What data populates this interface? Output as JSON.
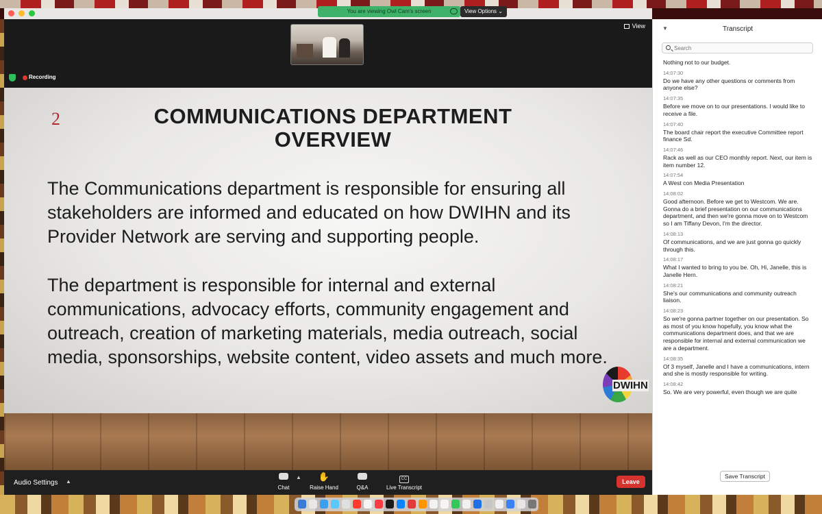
{
  "window": {
    "share_banner": "You are viewing Owl Cam's screen",
    "view_options": "View Options",
    "view_label": "View",
    "recording_label": "Recording"
  },
  "slide": {
    "number": "2",
    "title": "COMMUNICATIONS DEPARTMENT OVERVIEW",
    "paragraph_1": "The Communications department is responsible for ensuring all stakeholders are informed and educated on how DWIHN and its Provider Network are serving and supporting people.",
    "paragraph_2": "The department is responsible for internal and external communications, advocacy efforts, community engagement and outreach, creation of marketing materials, media outreach, social media, sponsorships, website content, video assets and much more.",
    "logo_text": "DWIHN"
  },
  "toolbar": {
    "audio_settings": "Audio Settings",
    "chat": "Chat",
    "raise_hand": "Raise Hand",
    "qa": "Q&A",
    "live_transcript": "Live Transcript",
    "leave": "Leave"
  },
  "transcript": {
    "title": "Transcript",
    "search_placeholder": "Search",
    "save_button": "Save Transcript",
    "entries": [
      {
        "time": "",
        "text": "Nothing not to our budget."
      },
      {
        "time": "14:07:30",
        "text": "Do we have any other questions or comments from anyone else?"
      },
      {
        "time": "14:07:35",
        "text": "Before we move on to our presentations. I would like to receive a file."
      },
      {
        "time": "14:07:40",
        "text": "The board chair report the executive Committee report finance Sd."
      },
      {
        "time": "14:07:46",
        "text": "Rack as well as our CEO monthly report. Next, our item is item number 12."
      },
      {
        "time": "14:07:54",
        "text": "A West con Media Presentation"
      },
      {
        "time": "14:08:02",
        "text": "Good afternoon. Before we get to Westcom. We are. Gonna do a brief presentation on our communications department, and then we're gonna move on to Westcom so I am Tiffany Devon, I'm the director."
      },
      {
        "time": "14:08:13",
        "text": "Of communications, and we are just gonna go quickly through this."
      },
      {
        "time": "14:08:17",
        "text": "What I wanted to bring to you be. Oh, Hi, Janelle, this is Janelle Hern."
      },
      {
        "time": "14:08:21",
        "text": "She's our communications and community outreach liaison."
      },
      {
        "time": "14:08:23",
        "text": "So we're gonna partner together on our presentation. So as most of you know hopefully, you know what the communications department does, and that we are responsible for internal and external communication we are a department."
      },
      {
        "time": "14:08:35",
        "text": "Of 3 myself, Janelle and I have a communications, intern and she is mostly responsible for writing."
      },
      {
        "time": "14:08:42",
        "text": "So. We are very powerful, even though we are quite"
      }
    ]
  }
}
